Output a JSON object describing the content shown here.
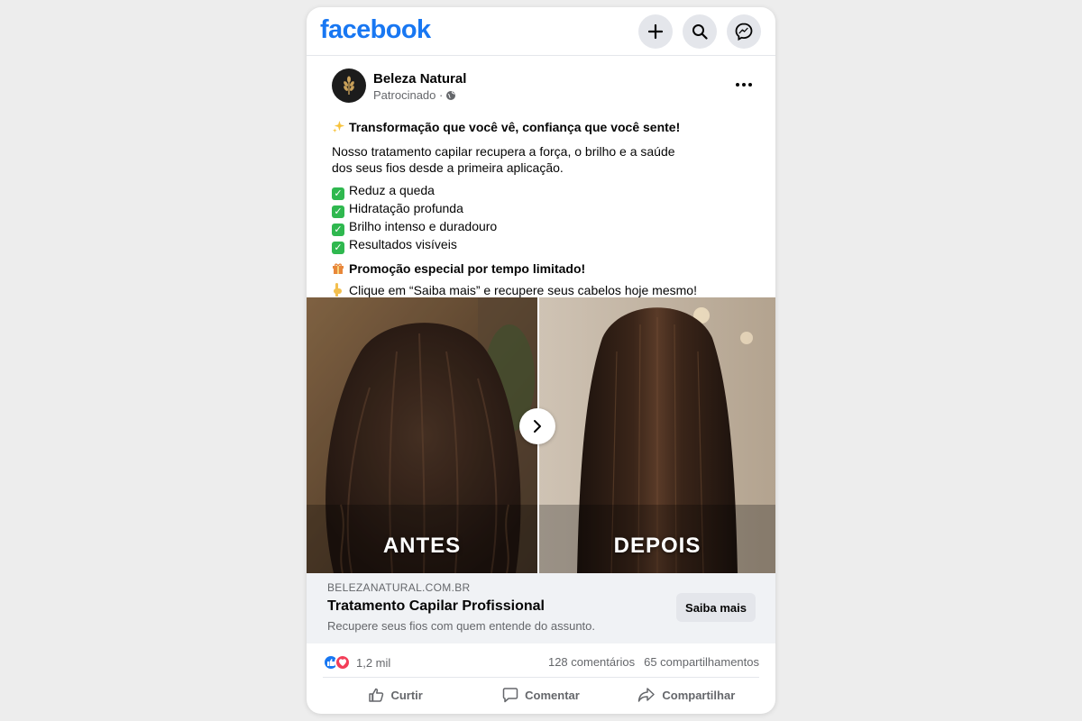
{
  "app": {
    "brand": "facebook",
    "brand_color": "#1877f2"
  },
  "topbar": {
    "icons": [
      "plus-icon",
      "search-icon",
      "messenger-icon"
    ]
  },
  "post": {
    "page_name": "Beleza Natural",
    "sponsored_label": "Patrocinado ·",
    "headline_text": "Transformação que você vê, confiança que você sente!",
    "body_line1": "Nosso tratamento capilar recupera a força, o brilho e a saúde",
    "body_line2": "dos seus fios desde a primeira aplicação.",
    "benefits": [
      "Reduz a queda",
      "Hidratação profunda",
      "Brilho intenso e duradouro",
      "Resultados visíveis"
    ],
    "promo": "Promoção especial por tempo limitado!",
    "cta_text": "Clique em “Saiba mais” e recupere seus cabelos hoje mesmo!"
  },
  "carousel": {
    "before_label": "ANTES",
    "after_label": "DEPOIS"
  },
  "link_card": {
    "domain": "BELEZANATURAL.COM.BR",
    "title": "Tratamento Capilar Profissional",
    "description": "Recupere seus fios com quem entende do assunto.",
    "button": "Saiba mais"
  },
  "stats": {
    "reactions": "1,2 mil",
    "comments": "128 comentários",
    "shares": "65 compartilhamentos"
  },
  "actions": {
    "like": "Curtir",
    "comment": "Comentar",
    "share": "Compartilhar"
  }
}
